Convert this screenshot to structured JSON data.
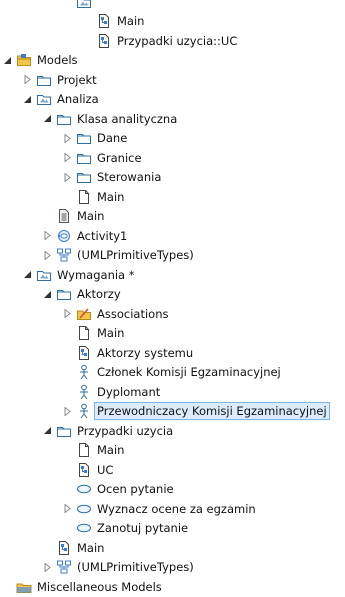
{
  "tree": {
    "items": [
      {
        "label": "",
        "level": 3,
        "toggle": "none",
        "icon": "model-icon"
      },
      {
        "label": "Main",
        "level": 4,
        "toggle": "none",
        "icon": "diagram-class-icon"
      },
      {
        "label": "Przypadki uzycia::UC",
        "level": 4,
        "toggle": "none",
        "icon": "diagram-class-icon"
      },
      {
        "label": "Models",
        "level": 0,
        "toggle": "expanded",
        "icon": "models-folder-icon"
      },
      {
        "label": "Projekt",
        "level": 1,
        "toggle": "collapsed",
        "icon": "package-icon"
      },
      {
        "label": "Analiza",
        "level": 1,
        "toggle": "expanded",
        "icon": "model-icon"
      },
      {
        "label": "Klasa analityczna",
        "level": 2,
        "toggle": "expanded",
        "icon": "package-icon"
      },
      {
        "label": "Dane",
        "level": 3,
        "toggle": "collapsed",
        "icon": "package-icon"
      },
      {
        "label": "Granice",
        "level": 3,
        "toggle": "collapsed",
        "icon": "package-icon"
      },
      {
        "label": "Sterowania",
        "level": 3,
        "toggle": "collapsed",
        "icon": "package-icon"
      },
      {
        "label": "Main",
        "level": 3,
        "toggle": "none",
        "icon": "diagram-icon"
      },
      {
        "label": "Main",
        "level": 2,
        "toggle": "none",
        "icon": "document-icon"
      },
      {
        "label": "Activity1",
        "level": 2,
        "toggle": "collapsed",
        "icon": "activity-icon"
      },
      {
        "label": "(UMLPrimitiveTypes)",
        "level": 2,
        "toggle": "collapsed",
        "icon": "primitive-types-icon"
      },
      {
        "label": "Wymagania *",
        "level": 1,
        "toggle": "expanded",
        "icon": "model-icon"
      },
      {
        "label": "Aktorzy",
        "level": 2,
        "toggle": "expanded",
        "icon": "package-icon"
      },
      {
        "label": "Associations",
        "level": 3,
        "toggle": "collapsed",
        "icon": "associations-folder-icon"
      },
      {
        "label": "Main",
        "level": 3,
        "toggle": "none",
        "icon": "diagram-icon"
      },
      {
        "label": "Aktorzy systemu",
        "level": 3,
        "toggle": "none",
        "icon": "diagram-class-icon"
      },
      {
        "label": "Członek Komisji Egzaminacyjnej",
        "level": 3,
        "toggle": "none",
        "icon": "actor-icon"
      },
      {
        "label": "Dyplomant",
        "level": 3,
        "toggle": "none",
        "icon": "actor-icon"
      },
      {
        "label": "Przewodniczacy Komisji Egzaminacyjnej",
        "level": 3,
        "toggle": "collapsed",
        "icon": "actor-icon",
        "selected": true
      },
      {
        "label": "Przypadki uzycia",
        "level": 2,
        "toggle": "expanded",
        "icon": "package-icon"
      },
      {
        "label": "Main",
        "level": 3,
        "toggle": "none",
        "icon": "diagram-icon"
      },
      {
        "label": "UC",
        "level": 3,
        "toggle": "none",
        "icon": "diagram-class-icon"
      },
      {
        "label": "Ocen pytanie",
        "level": 3,
        "toggle": "none",
        "icon": "use-case-icon"
      },
      {
        "label": "Wyznacz ocene za egzamin",
        "level": 3,
        "toggle": "collapsed",
        "icon": "use-case-icon"
      },
      {
        "label": "Zanotuj pytanie",
        "level": 3,
        "toggle": "none",
        "icon": "use-case-icon"
      },
      {
        "label": "Main",
        "level": 2,
        "toggle": "none",
        "icon": "diagram-class-icon"
      },
      {
        "label": "(UMLPrimitiveTypes)",
        "level": 2,
        "toggle": "collapsed",
        "icon": "primitive-types-icon"
      },
      {
        "label": "Miscellaneous Models",
        "level": 0,
        "toggle": "none",
        "icon": "misc-folder-icon"
      }
    ]
  }
}
